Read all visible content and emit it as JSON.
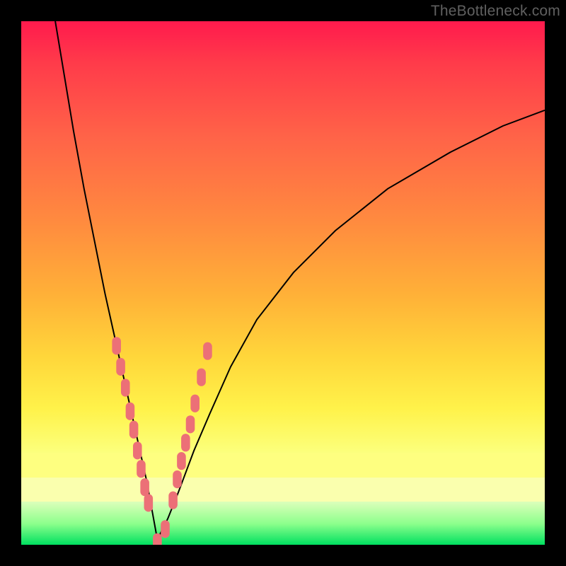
{
  "watermark": "TheBottleneck.com",
  "colors": {
    "marker": "#ec7077",
    "curve": "#000000"
  },
  "chart_data": {
    "type": "line",
    "title": "",
    "xlabel": "",
    "ylabel": "",
    "xlim": [
      0,
      100
    ],
    "ylim": [
      0,
      100
    ],
    "note": "V-shaped bottleneck curve on red→green gradient; x/y axes unlabeled. y read as percent from top (0) to bottom (100). Minimum at x≈26.",
    "series": [
      {
        "name": "bottleneck-curve",
        "x": [
          6.5,
          8,
          10,
          12,
          14,
          16,
          18,
          20,
          22,
          24,
          26,
          28,
          30,
          33,
          36,
          40,
          45,
          52,
          60,
          70,
          82,
          92,
          100
        ],
        "y": [
          0,
          9,
          21,
          32,
          42,
          52,
          61,
          70,
          79,
          88,
          99,
          95,
          90,
          82,
          75,
          66,
          57,
          48,
          40,
          32,
          25,
          20,
          17
        ]
      }
    ],
    "scatter_points": {
      "name": "highlighted-data",
      "x": [
        18.2,
        19.0,
        19.9,
        20.8,
        21.5,
        22.2,
        22.9,
        23.6,
        24.3,
        26.0,
        27.5,
        29.0,
        29.8,
        30.6,
        31.4,
        32.3,
        33.2,
        34.4,
        35.6
      ],
      "y": [
        62.0,
        66.0,
        70.0,
        74.5,
        78.0,
        82.0,
        85.5,
        89.0,
        92.0,
        99.5,
        97.0,
        91.5,
        87.5,
        84.0,
        80.5,
        77.0,
        73.0,
        68.0,
        63.0
      ]
    }
  }
}
